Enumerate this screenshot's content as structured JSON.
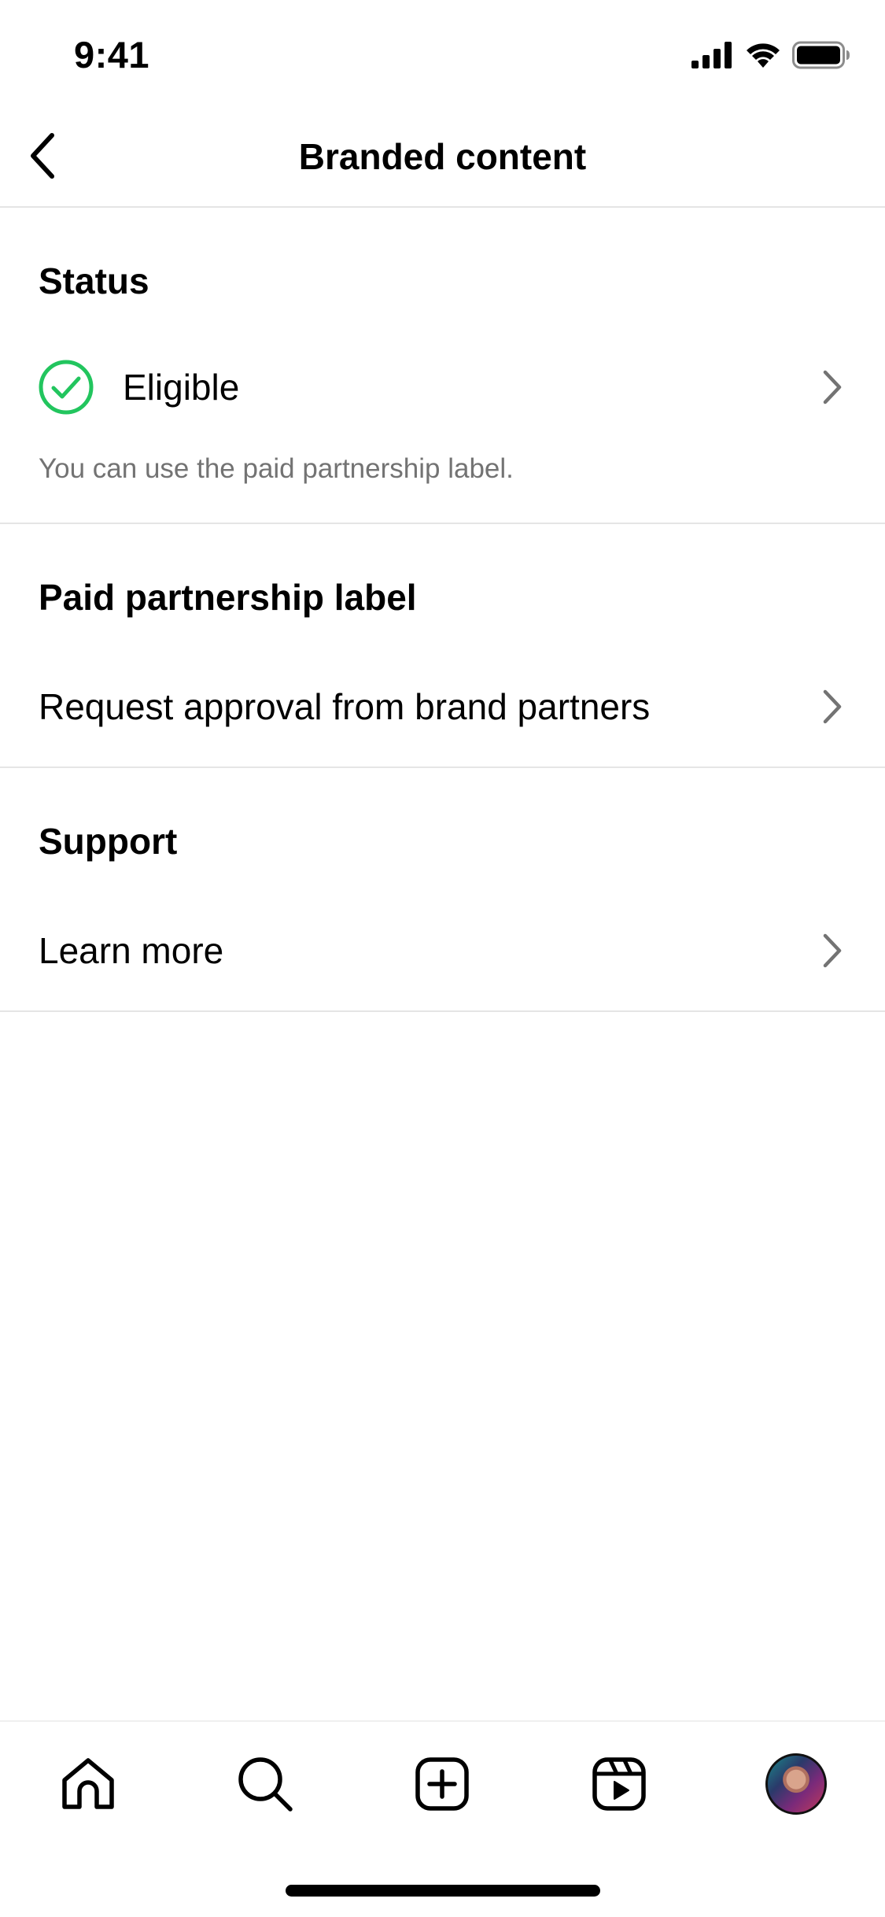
{
  "status_bar": {
    "time": "9:41"
  },
  "header": {
    "title": "Branded content",
    "back_icon": "chevron-left-icon"
  },
  "sections": {
    "status": {
      "header": "Status",
      "item_label": "Eligible",
      "item_icon": "check-circle-icon",
      "item_icon_color": "#22c55e",
      "description": "You can use the paid partnership label."
    },
    "paid_partnership": {
      "header": "Paid partnership label",
      "item_label": "Request approval from brand partners"
    },
    "support": {
      "header": "Support",
      "item_label": "Learn more"
    }
  },
  "tab_bar": {
    "tabs": [
      "home-icon",
      "search-icon",
      "create-icon",
      "reels-icon",
      "profile-avatar"
    ]
  },
  "colors": {
    "divider": "#e5e5e5",
    "secondary_text": "#737373",
    "chevron": "#737373",
    "success": "#22c55e"
  }
}
